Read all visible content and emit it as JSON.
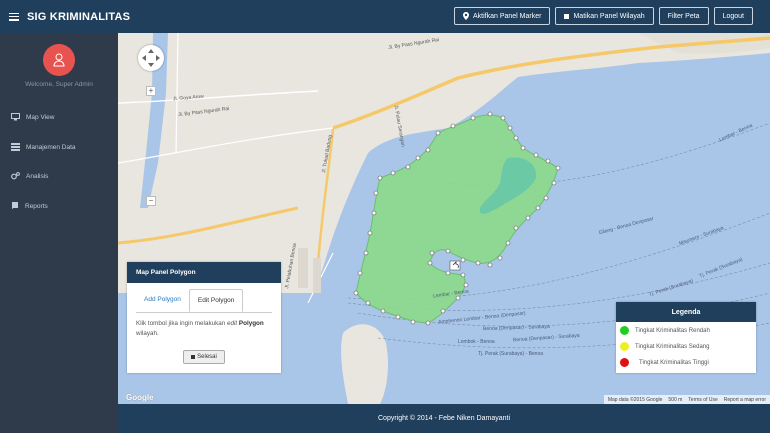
{
  "app": {
    "title": "SIG KRIMINALITAS",
    "menu_icon": "hamburger-icon"
  },
  "header": {
    "buttons": [
      {
        "label": "Aktifkan Panel Marker",
        "icon": "map-marker-icon"
      },
      {
        "label": "Matikan Panel Wilayah",
        "icon": "stop-icon"
      },
      {
        "label": "Filter Peta"
      },
      {
        "label": "Logout"
      }
    ]
  },
  "sidebar": {
    "welcome": "Welcome, Super Admin",
    "avatar_icon": "user-icon",
    "items": [
      {
        "label": "Map View",
        "icon": "monitor-icon"
      },
      {
        "label": "Manajemen Data",
        "icon": "list-icon"
      },
      {
        "label": "Analisis",
        "icon": "gears-icon"
      },
      {
        "label": "Reports",
        "icon": "book-icon"
      }
    ]
  },
  "map": {
    "road_labels": [
      "Jl. By Pass Ngurah Rai",
      "Jl. By Pass Ngurah Rai",
      "Jl. Goya Arow",
      "Jl. Pelabuhan Benoa",
      "Jl. Tukad Badung",
      "Jl. Pulau Serangan"
    ],
    "route_labels": [
      "Gilang - Benoa Denpasar",
      "Lembar - Benoa",
      "Amphenon Lembar - Benoa (Denpasar)",
      "Benoa (Denpasar) - Surabaya",
      "Lombok - Benoa",
      "Benoa (Denpasar) - Surabaya",
      "Tj. Perak (Surabaya) - Benoa",
      "Maumere - Surabaya",
      "Tj. Perak (Surabaya)",
      "Tj. Perak (Surabaya)",
      "Lembar - Benoa"
    ],
    "google_logo": "Google",
    "attribution": [
      "Map data ©2015 Google",
      "500 m",
      "Terms of Use",
      "Report a map error"
    ]
  },
  "polygon_panel": {
    "title": "Map Panel Polygon",
    "tabs": [
      "Add Polygon",
      "Edit Polygon"
    ],
    "active_tab": "Edit Polygon",
    "text_prefix": "Klik tombol jika ingin melakukan",
    "text_em": "edit",
    "text_strong": "Polygon",
    "text_suffix": "wilayah.",
    "button_label": "Selesai"
  },
  "legend": {
    "title": "Legenda",
    "items": [
      {
        "label": "Tingkat Kriminalitas Rendah",
        "color": "#22cc22"
      },
      {
        "label": "Tingkat Kriminalitas Sedang",
        "color": "#eeee22"
      },
      {
        "label": "Tingkat Kriminalitas Tinggi",
        "color": "#dd1111"
      }
    ]
  },
  "footer": {
    "text": "Copyright © 2014 - Febe Niken Damayanti"
  },
  "colors": {
    "navbar": "#1f3f5c",
    "sidebar": "#2f3b4a",
    "water": "#a9c5e8",
    "land": "#e9e6df",
    "polygon_fill": "#8bd98b",
    "avatar": "#e9534f"
  }
}
